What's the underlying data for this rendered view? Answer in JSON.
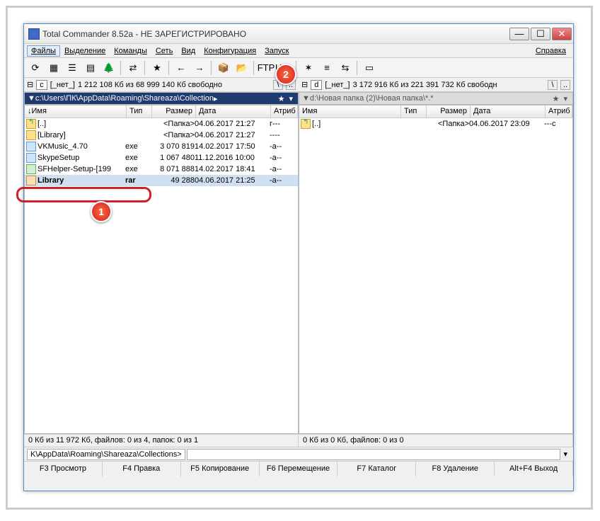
{
  "window": {
    "title": "Total Commander 8.52a - НЕ ЗАРЕГИСТРИРОВАНО"
  },
  "menu": {
    "items": [
      "Файлы",
      "Выделение",
      "Команды",
      "Сеть",
      "Вид",
      "Конфигурация",
      "Запуск"
    ],
    "right": "Справка",
    "active_index": 0
  },
  "drives": {
    "left": {
      "letter": "c",
      "label": "[_нет_]",
      "free": "1 212 108 Кб из 68 999 140 Кб свободно"
    },
    "right": {
      "letter": "d",
      "label": "[_нет_]",
      "free": "3 172 916 Кб из 221 391 732 Кб свободн"
    }
  },
  "paths": {
    "left": "c:\\Users\\ПК\\AppData\\Roaming\\Shareaza\\Collection",
    "right": "d:\\Новая папка (2)\\Новая папка\\*.*"
  },
  "columns": {
    "name": "Имя",
    "ext": "Тип",
    "size": "Размер",
    "date": "Дата",
    "attr": "Атриб"
  },
  "left_rows": [
    {
      "icon": "up",
      "name": "[..]",
      "ext": "",
      "size": "<Папка>",
      "date": "04.06.2017 21:27",
      "attr": "г---"
    },
    {
      "icon": "folder",
      "name": "[Library]",
      "ext": "",
      "size": "<Папка>",
      "date": "04.06.2017 21:27",
      "attr": "----"
    },
    {
      "icon": "exe",
      "name": "VKMusic_4.70",
      "ext": "exe",
      "size": "3 070 819",
      "date": "14.02.2017 17:50",
      "attr": "-a--"
    },
    {
      "icon": "exe",
      "name": "SkypeSetup",
      "ext": "exe",
      "size": "1 067 480",
      "date": "11.12.2016 10:00",
      "attr": "-a--"
    },
    {
      "icon": "exe2",
      "name": "SFHelper-Setup-[199",
      "ext": "exe",
      "size": "8 071 888",
      "date": "14.02.2017 18:41",
      "attr": "-a--"
    },
    {
      "icon": "rar",
      "name": "Library",
      "ext": "rar",
      "size": "49 288",
      "date": "04.06.2017 21:25",
      "attr": "-a--",
      "selected": true
    }
  ],
  "right_rows": [
    {
      "icon": "up",
      "name": "[..]",
      "ext": "",
      "size": "<Папка>",
      "date": "04.06.2017 23:09",
      "attr": "---c"
    }
  ],
  "status": {
    "left": "0 Кб из 11 972 Кб, файлов: 0 из 4, папок: 0 из 1",
    "right": "0 Кб из 0 Кб, файлов: 0 из 0"
  },
  "cmdline": {
    "path": "K\\AppData\\Roaming\\Shareaza\\Collections>"
  },
  "fkeys": [
    "F3 Просмотр",
    "F4 Правка",
    "F5 Копирование",
    "F6 Перемещение",
    "F7 Каталог",
    "F8 Удаление",
    "Alt+F4 Выход"
  ],
  "markers": {
    "1": "1",
    "2": "2"
  },
  "toolbar_icons": [
    "refresh",
    "view-brief",
    "view-full",
    "view-thumbs",
    "tree",
    "sep",
    "swap",
    "sep",
    "star",
    "sep",
    "back",
    "forward",
    "sep",
    "pack",
    "unpack",
    "sep",
    "ftp",
    "url",
    "sep",
    "notepad",
    "wordwrap",
    "compare",
    "sep",
    "doc"
  ]
}
